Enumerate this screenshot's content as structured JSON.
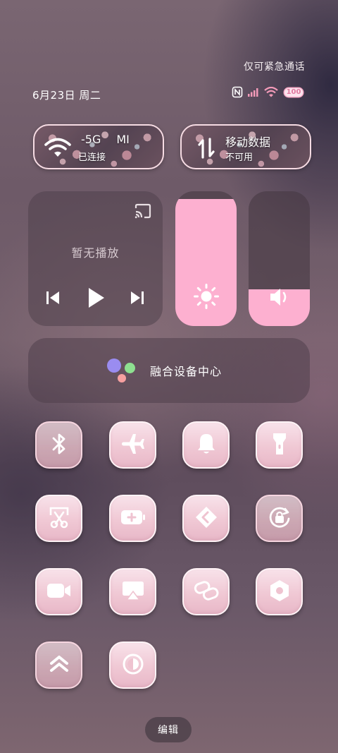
{
  "status": {
    "emergency_text": "仅可紧急通话",
    "date_text": "6月23日 周二",
    "battery_level": "100"
  },
  "wifi_tile": {
    "name": "-5G",
    "name_extra": "MI",
    "status": "已连接",
    "icon": "wifi-icon",
    "active": true
  },
  "data_tile": {
    "name": "移动数据",
    "status": "不可用",
    "icon": "mobile-data-icon",
    "active": true
  },
  "media": {
    "placeholder": "暂无播放",
    "controls": [
      "previous-icon",
      "play-icon",
      "next-icon"
    ],
    "cast_icon": "cast-icon"
  },
  "brightness": {
    "level": 0.94,
    "icon": "sun-icon"
  },
  "volume": {
    "level": 0.27,
    "icon": "speaker-icon"
  },
  "hub": {
    "label": "融合设备中心"
  },
  "toggles": [
    {
      "id": "bluetooth",
      "icon": "bluetooth-icon",
      "active": true
    },
    {
      "id": "airplane",
      "icon": "airplane-icon",
      "active": false
    },
    {
      "id": "ringer",
      "icon": "bell-icon",
      "active": false
    },
    {
      "id": "flashlight",
      "icon": "flashlight-icon",
      "active": false
    },
    {
      "id": "screenshot",
      "icon": "scissors-icon",
      "active": false
    },
    {
      "id": "battery-saver",
      "icon": "battery-saver-icon",
      "active": false
    },
    {
      "id": "nearby-share",
      "icon": "nearby-share-icon",
      "active": false
    },
    {
      "id": "rotation-lock",
      "icon": "rotation-lock-icon",
      "active": true
    },
    {
      "id": "screen-record",
      "icon": "video-camera-icon",
      "active": false
    },
    {
      "id": "screen-cast",
      "icon": "screen-cast-icon",
      "active": false
    },
    {
      "id": "link",
      "icon": "link-icon",
      "active": false
    },
    {
      "id": "settings",
      "icon": "hexagon-settings-icon",
      "active": false
    },
    {
      "id": "performance",
      "icon": "double-chevron-up-icon",
      "active": true
    },
    {
      "id": "eye-comfort",
      "icon": "half-circle-icon",
      "active": false
    }
  ],
  "footer": {
    "edit_label": "编辑"
  },
  "colors": {
    "accent_pink": "#fdb0d0",
    "tile_pink": "#f0c8d4",
    "signal_pink": "#f29ab8"
  }
}
